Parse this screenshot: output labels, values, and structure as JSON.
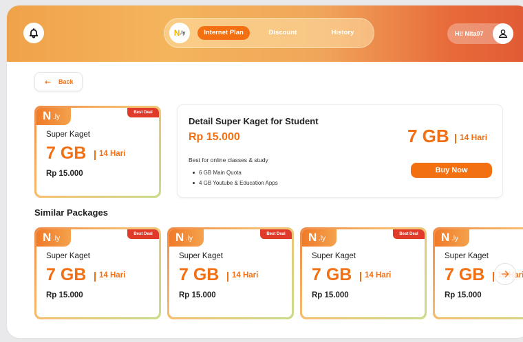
{
  "header": {
    "nav": {
      "logo": {
        "n": "N",
        "ly": ".ly"
      },
      "tabs": [
        {
          "label": "Internet Plan",
          "active": true
        },
        {
          "label": "Discount",
          "active": false
        },
        {
          "label": "History",
          "active": false
        }
      ]
    },
    "user": {
      "greeting": "Hi! Nita07"
    }
  },
  "back": {
    "label": "Back"
  },
  "selected": {
    "logo_n": "N",
    "logo_ly": ".ly",
    "badge": "Best Deal",
    "name": "Super Kaget",
    "quota": "7 GB",
    "days": "14 Hari",
    "price": "Rp 15.000"
  },
  "detail": {
    "title": "Detail Super Kaget for Student",
    "price": "Rp 15.000",
    "description": "Best for online classes & study",
    "items": [
      "6 GB Main Quota",
      "4 GB Youtube & Education Apps"
    ],
    "quota": "7 GB",
    "days": "14 Hari",
    "buy_label": "Buy Now"
  },
  "similar": {
    "title": "Similar Packages",
    "cards": [
      {
        "logo_n": "N",
        "logo_ly": ".ly",
        "badge": "Best Deal",
        "name": "Super Kaget",
        "quota": "7 GB",
        "days": "14 Hari",
        "price": "Rp 15.000"
      },
      {
        "logo_n": "N",
        "logo_ly": ".ly",
        "badge": "Best Deal",
        "name": "Super Kaget",
        "quota": "7 GB",
        "days": "14 Hari",
        "price": "Rp 15.000"
      },
      {
        "logo_n": "N",
        "logo_ly": ".ly",
        "badge": "Best Deal",
        "name": "Super Kaget",
        "quota": "7 GB",
        "days": "14 Hari",
        "price": "Rp 15.000"
      },
      {
        "logo_n": "N",
        "logo_ly": ".ly",
        "badge": "",
        "name": "Super Kaget",
        "quota": "7 GB",
        "days": "14 Hari",
        "price": "Rp 15.000"
      }
    ]
  },
  "colors": {
    "accent": "#f26f12",
    "badge": "#e03a2a"
  },
  "icons": {
    "bell": "bell-icon",
    "user": "user-icon",
    "back": "arrow-left-icon",
    "next": "arrow-right-icon"
  }
}
